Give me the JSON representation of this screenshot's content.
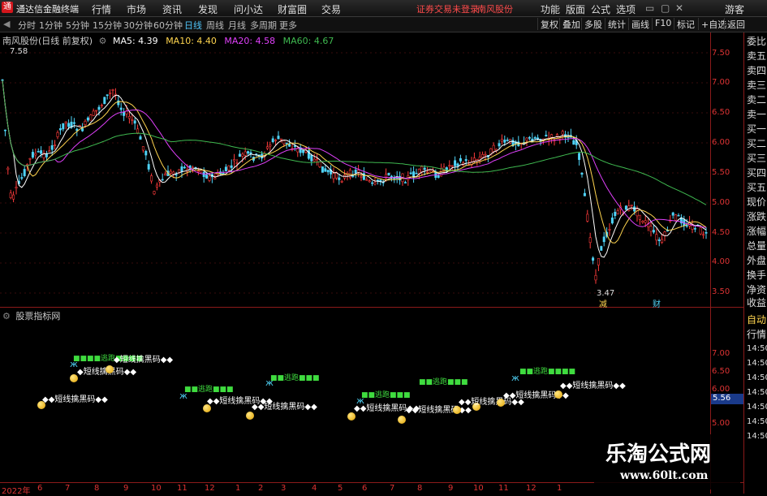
{
  "menu": {
    "app_title": "通达信金融终端",
    "items": [
      "行情",
      "市场",
      "资讯",
      "发现",
      "问小达",
      "财富圈",
      "交易"
    ],
    "alert": "证券交易未登录",
    "stock": "南风股份",
    "right": [
      "功能",
      "版面",
      "公式",
      "选项"
    ],
    "guest": "游客"
  },
  "toolbar": {
    "periods": [
      "分时",
      "1分钟",
      "5分钟",
      "15分钟",
      "30分钟",
      "60分钟",
      "日线",
      "周线",
      "月线",
      "多周期",
      "更多"
    ],
    "active_period": "日线",
    "right_buttons": [
      "复权",
      "叠加",
      "多股",
      "统计",
      "画线",
      "F10",
      "标记",
      "+自选",
      "返回"
    ]
  },
  "main_panel": {
    "title": "南风股份(日线 前复权)",
    "ma5": "MA5: 4.39",
    "ma10": "MA10: 4.40",
    "ma20": "MA20: 4.58",
    "ma60": "MA60: 4.67",
    "high_label": "7.58",
    "low_label": "3.47",
    "event_labels": [
      "减",
      "财"
    ],
    "y_ticks": [
      "7.50",
      "7.00",
      "6.50",
      "6.00",
      "5.50",
      "5.00",
      "4.50",
      "4.00",
      "3.50"
    ]
  },
  "sub_panel": {
    "title": "股票指标网",
    "y_ticks": [
      "7.00",
      "6.50",
      "6.00",
      "5.50",
      "5.00"
    ],
    "current_value": "5.56",
    "signal_text": "短线擒黑码",
    "escape_text": "逃跑"
  },
  "right_quote": {
    "labels": [
      "委比",
      "卖五",
      "卖四",
      "卖三",
      "卖二",
      "卖一",
      "买一",
      "买二",
      "买三",
      "买四",
      "买五",
      "现价",
      "涨跌",
      "涨幅",
      "总量",
      "外盘",
      "换手",
      "净资",
      "收益"
    ],
    "tabs": [
      "自动",
      "行情"
    ],
    "times": [
      "14:50",
      "14:50",
      "14:50",
      "14:50",
      "14:50",
      "14:50",
      "14:50"
    ]
  },
  "x_axis": {
    "labels": [
      "2022年",
      "6",
      "7",
      "8",
      "9",
      "10",
      "11",
      "12",
      "1",
      "2",
      "3",
      "4",
      "5",
      "6",
      "7",
      "8",
      "9",
      "10",
      "11",
      "12",
      "1"
    ]
  },
  "watermark": {
    "cn": "乐淘公式网",
    "url": "www.60lt.com"
  },
  "colors": {
    "background": "#000000",
    "grid": "#8b1a1a",
    "up": "#ff3b3b",
    "down": "#4fd3f7",
    "ma5": "#ffffff",
    "ma10": "#ffd54f",
    "ma20": "#e040fb",
    "ma60": "#3fb950"
  }
}
